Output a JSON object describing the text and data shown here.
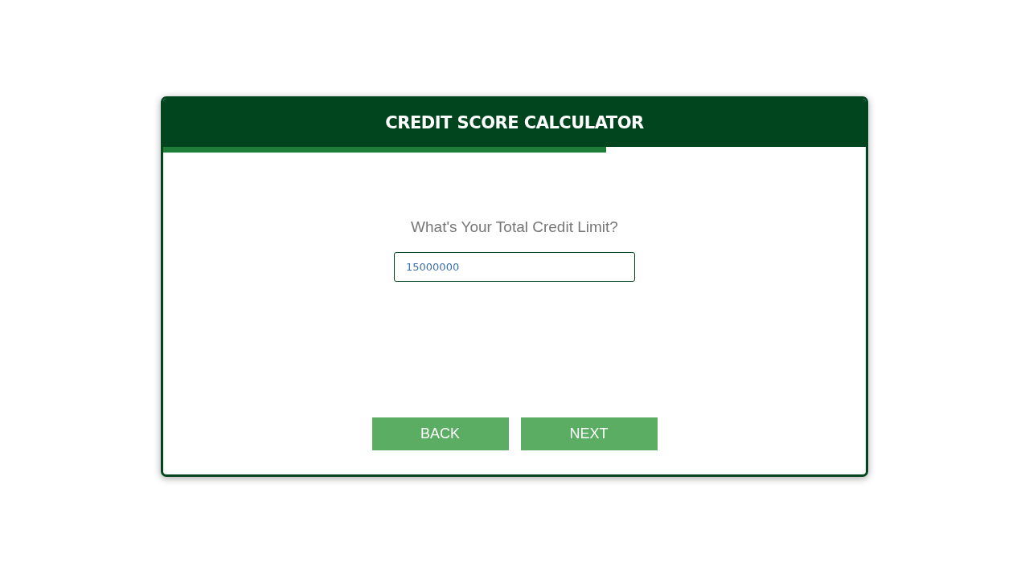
{
  "header": {
    "title": "CREDIT SCORE CALCULATOR"
  },
  "progress": {
    "level": 0.63
  },
  "question": {
    "label": "What's Your Total Credit Limit?",
    "value": "15000000"
  },
  "buttons": [
    {
      "label": "BACK"
    },
    {
      "label": "NEXT"
    }
  ]
}
